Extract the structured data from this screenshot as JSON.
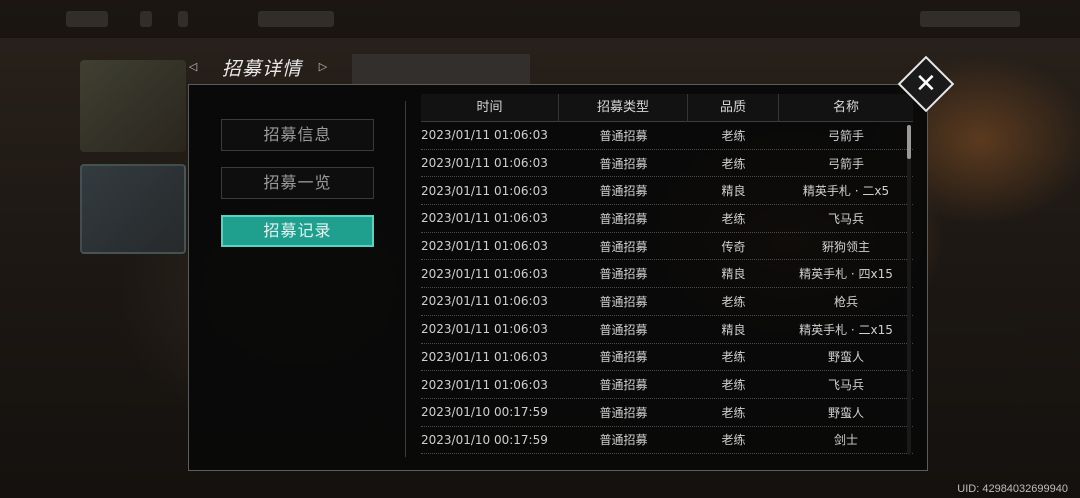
{
  "header": {
    "title": "招募详情"
  },
  "tabs": [
    {
      "label": "招募信息",
      "active": false
    },
    {
      "label": "招募一览",
      "active": false
    },
    {
      "label": "招募记录",
      "active": true
    }
  ],
  "table": {
    "columns": [
      "时间",
      "招募类型",
      "品质",
      "名称"
    ],
    "rows": [
      [
        "2023/01/11  01:06:03",
        "普通招募",
        "老练",
        "弓箭手"
      ],
      [
        "2023/01/11  01:06:03",
        "普通招募",
        "老练",
        "弓箭手"
      ],
      [
        "2023/01/11  01:06:03",
        "普通招募",
        "精良",
        "精英手札 · 二x5"
      ],
      [
        "2023/01/11  01:06:03",
        "普通招募",
        "老练",
        "飞马兵"
      ],
      [
        "2023/01/11  01:06:03",
        "普通招募",
        "传奇",
        "豣狗领主"
      ],
      [
        "2023/01/11  01:06:03",
        "普通招募",
        "精良",
        "精英手札 · 四x15"
      ],
      [
        "2023/01/11  01:06:03",
        "普通招募",
        "老练",
        "枪兵"
      ],
      [
        "2023/01/11  01:06:03",
        "普通招募",
        "精良",
        "精英手札 · 二x15"
      ],
      [
        "2023/01/11  01:06:03",
        "普通招募",
        "老练",
        "野蛮人"
      ],
      [
        "2023/01/11  01:06:03",
        "普通招募",
        "老练",
        "飞马兵"
      ],
      [
        "2023/01/10  00:17:59",
        "普通招募",
        "老练",
        "野蛮人"
      ],
      [
        "2023/01/10  00:17:59",
        "普通招募",
        "老练",
        "剑士"
      ]
    ]
  },
  "footer": {
    "uid": "UID: 42984032699940"
  },
  "colors": {
    "accent": "#1f9f8e",
    "accent_border": "#56d4c2"
  }
}
